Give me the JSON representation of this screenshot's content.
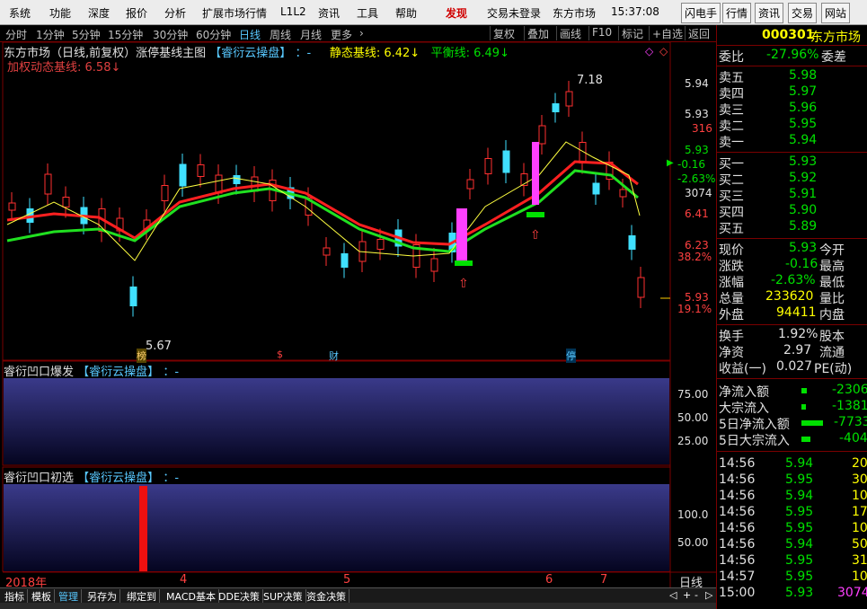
{
  "menu": {
    "items": [
      "系统",
      "功能",
      "深度",
      "报价",
      "分析",
      "扩展市场行情",
      "L1L2",
      "资讯",
      "工具",
      "帮助"
    ],
    "discover": "发现",
    "trade_status": "交易未登录",
    "market": "东方市场",
    "time": "15:37:08",
    "right_buttons": [
      "闪电手",
      "行情",
      "资讯",
      "交易",
      "网站"
    ]
  },
  "timeframes": [
    "分时",
    "1分钟",
    "5分钟",
    "15分钟",
    "30分钟",
    "60分钟",
    "日线",
    "周线",
    "月线",
    "更多"
  ],
  "timeframe_active": "日线",
  "toolbar_buttons": [
    "复权",
    "叠加",
    "画线",
    "F10",
    "标记",
    "+自选",
    "返回"
  ],
  "main_chart": {
    "title_prefix": "东方市场（日线,前复权）涨停基线主图",
    "brand": "【睿衍云操盘】",
    "dash": "：-",
    "static_label": "静态基线:",
    "static_value": "6.42↓",
    "balance_label": "平衡线:",
    "balance_value": "6.49↓",
    "weighted_label": "加权动态基线:",
    "weighted_value": "6.58↓",
    "high_marker": "7.18",
    "low_marker": "5.67",
    "event_markers": [
      "榜",
      "$",
      "财",
      "停"
    ],
    "y_labels": [
      "5.94",
      "5.93",
      "316",
      "5.93",
      "-0.16",
      "-2.63%",
      "3074",
      "6.41",
      "6.23",
      "38.2%",
      "5.93",
      "19.1%"
    ]
  },
  "chart_data": [
    {
      "type": "candlestick",
      "title": "东方市场（日线,前复权）涨停基线主图",
      "x_labels": [
        "2018年",
        "4",
        "5",
        "6",
        "7"
      ],
      "y_labels": [
        "5.94",
        "5.93",
        "6.41",
        "6.23",
        "5.93"
      ],
      "annotations": [
        "7.18",
        "5.67"
      ],
      "series": [
        {
          "name": "静态基线",
          "values": [
            6.42
          ]
        },
        {
          "name": "平衡线",
          "values": [
            6.49
          ]
        },
        {
          "name": "加权动态基线",
          "values": [
            6.58
          ]
        }
      ]
    },
    {
      "type": "area",
      "title": "睿衍凹口爆发",
      "y_ticks": [
        "75.00",
        "50.00",
        "25.00"
      ]
    },
    {
      "type": "bar",
      "title": "睿衍凹口初选",
      "y_ticks": [
        "100.0",
        "50.00"
      ]
    }
  ],
  "sub1": {
    "title": "睿衍凹口爆发",
    "brand": "【睿衍云操盘】",
    "dash": "：-",
    "ticks": [
      "75.00",
      "50.00",
      "25.00"
    ]
  },
  "sub2": {
    "title": "睿衍凹口初选",
    "brand": "【睿衍云操盘】",
    "dash": "：-",
    "ticks": [
      "100.0",
      "50.00"
    ]
  },
  "x_axis": {
    "labels": [
      "2018年",
      "4",
      "5",
      "6",
      "7"
    ],
    "scale_label": "日线"
  },
  "bottom_tabs": [
    "指标",
    "模板",
    "管理",
    "另存为",
    "绑定到",
    "MACD基本",
    "DDE决策",
    "SUP决策",
    "资金决策"
  ],
  "bottom_tab_active": "管理",
  "bottom_ctrl": [
    "◁",
    "+",
    "-",
    "▷"
  ],
  "quote": {
    "code": "000301",
    "name": "东方市场",
    "weibi_label": "委比",
    "weibi_value": "-27.96%",
    "weicha_label": "委差",
    "sells": [
      {
        "label": "卖五",
        "price": "5.98"
      },
      {
        "label": "卖四",
        "price": "5.97"
      },
      {
        "label": "卖三",
        "price": "5.96"
      },
      {
        "label": "卖二",
        "price": "5.95"
      },
      {
        "label": "卖一",
        "price": "5.94"
      }
    ],
    "buys": [
      {
        "label": "买一",
        "price": "5.93"
      },
      {
        "label": "买二",
        "price": "5.92"
      },
      {
        "label": "买三",
        "price": "5.91"
      },
      {
        "label": "买四",
        "price": "5.90"
      },
      {
        "label": "买五",
        "price": "5.89"
      }
    ],
    "stats": [
      {
        "l1": "现价",
        "v1": "5.93",
        "l2": "今开"
      },
      {
        "l1": "涨跌",
        "v1": "-0.16",
        "l2": "最高"
      },
      {
        "l1": "涨幅",
        "v1": "-2.63%",
        "l2": "最低"
      },
      {
        "l1": "总量",
        "v1": "233620",
        "l2": "量比"
      },
      {
        "l1": "外盘",
        "v1": "94411",
        "l2": "内盘"
      }
    ],
    "stats2": [
      {
        "l1": "换手",
        "v1": "1.92%",
        "l2": "股本"
      },
      {
        "l1": "净资",
        "v1": "2.97",
        "l2": "流通"
      },
      {
        "l1": "收益(一)",
        "v1": "0.027",
        "l2": "PE(动)"
      }
    ],
    "flows": [
      {
        "label": "净流入额",
        "value": "-2306"
      },
      {
        "label": "大宗流入",
        "value": "-1381"
      },
      {
        "label": "5日净流入额",
        "value": "-7733"
      },
      {
        "label": "5日大宗流入",
        "value": "-404"
      }
    ],
    "ticks": [
      {
        "time": "14:56",
        "price": "5.94",
        "vol": "20"
      },
      {
        "time": "14:56",
        "price": "5.95",
        "vol": "30"
      },
      {
        "time": "14:56",
        "price": "5.94",
        "vol": "10"
      },
      {
        "time": "14:56",
        "price": "5.95",
        "vol": "17"
      },
      {
        "time": "14:56",
        "price": "5.95",
        "vol": "10"
      },
      {
        "time": "14:56",
        "price": "5.94",
        "vol": "50"
      },
      {
        "time": "14:56",
        "price": "5.95",
        "vol": "31"
      },
      {
        "time": "14:57",
        "price": "5.95",
        "vol": "10"
      },
      {
        "time": "15:00",
        "price": "5.93",
        "vol": "3074"
      }
    ]
  },
  "colors": {
    "up": "#ff3030",
    "down": "#40e0ff",
    "ma_red": "#ff2020",
    "ma_green": "#20e020",
    "ma_yellow": "#ffff40",
    "panel_grad_top": "#3a3a8a",
    "panel_grad_bottom": "#050520"
  }
}
